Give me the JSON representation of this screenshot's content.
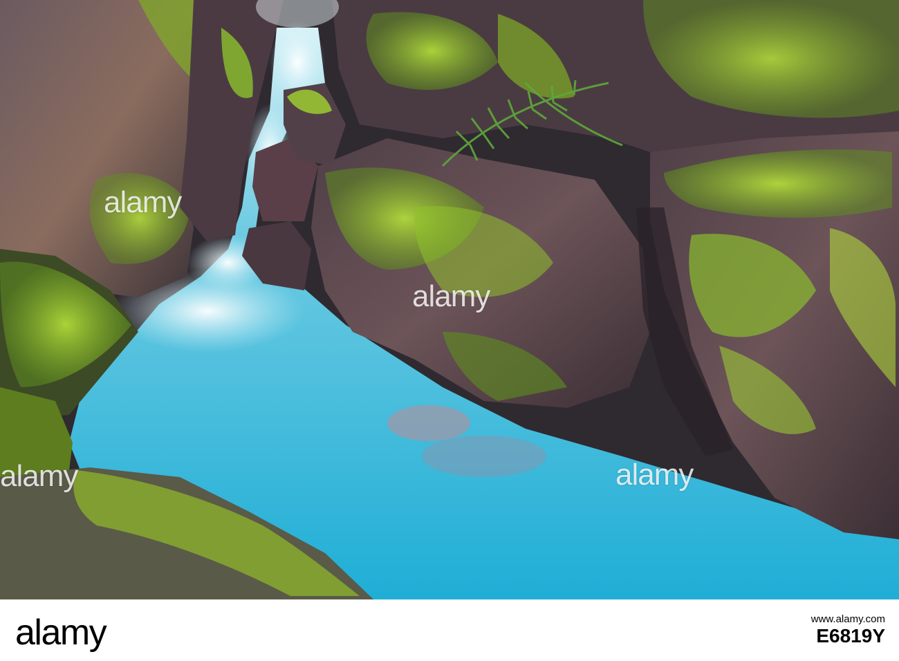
{
  "watermark": {
    "text": "alamy"
  },
  "footer": {
    "logo": "alamy",
    "caption_line1": "www.alamy.com",
    "image_id": "E6819Y"
  },
  "colors": {
    "water": "#3fb6d6",
    "moss": "#8ec42b",
    "rock": "#5a4950"
  }
}
